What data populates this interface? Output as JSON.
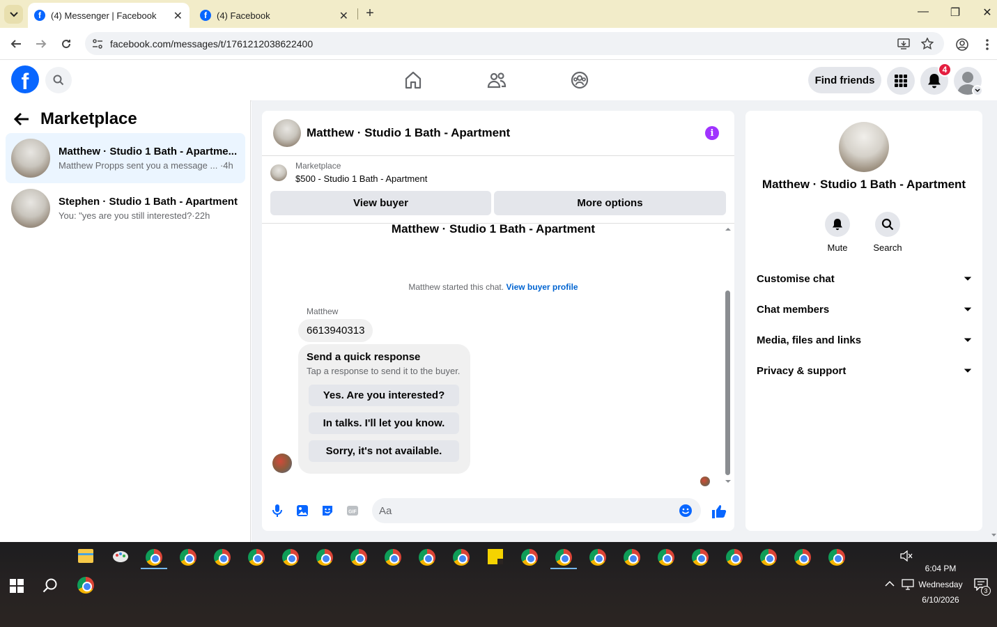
{
  "browser": {
    "tabs": [
      {
        "title": "(4) Messenger | Facebook",
        "active": true
      },
      {
        "title": "(4) Facebook",
        "active": false
      }
    ],
    "url": "facebook.com/messages/t/1761212038622400"
  },
  "fbnav": {
    "find_friends": "Find friends",
    "notif_count": "4"
  },
  "sidebar": {
    "title": "Marketplace",
    "conversations": [
      {
        "name": "Matthew · Studio 1 Bath - Apartme...",
        "preview": "Matthew Propps sent you a message ... ·4h",
        "selected": true
      },
      {
        "name": "Stephen · Studio 1 Bath - Apartment",
        "preview": "You: \"yes are you still interested?·22h",
        "selected": false
      }
    ]
  },
  "chat": {
    "header_title": "Matthew · Studio 1 Bath - Apartment",
    "listing_source": "Marketplace",
    "listing_title": "$500 - Studio 1 Bath - Apartment",
    "view_buyer": "View buyer",
    "more_options": "More options",
    "thread_title": "Matthew · Studio 1 Bath - Apartment",
    "started_text": "Matthew started this chat.",
    "started_link": "View buyer profile",
    "sender": "Matthew",
    "phone_message": "6613940313",
    "quick_title": "Send a quick response",
    "quick_sub": "Tap a response to send it to the buyer.",
    "quick_responses": [
      "Yes. Are you interested?",
      "In talks. I'll let you know.",
      "Sorry, it's not available."
    ],
    "input_placeholder": "Aa"
  },
  "details": {
    "name": "Matthew · Studio 1 Bath - Apartment",
    "actions": [
      "Mute",
      "Search"
    ],
    "sections": [
      "Customise chat",
      "Chat members",
      "Media, files and links",
      "Privacy & support"
    ]
  },
  "taskbar": {
    "time": "6:04 PM",
    "day": "Wednesday",
    "date": "6/10/2026",
    "notif_count": "3"
  },
  "colors": {
    "fb_blue": "#0866ff",
    "accent_purple": "#a033ff",
    "selected_bg": "#ebf5ff"
  }
}
